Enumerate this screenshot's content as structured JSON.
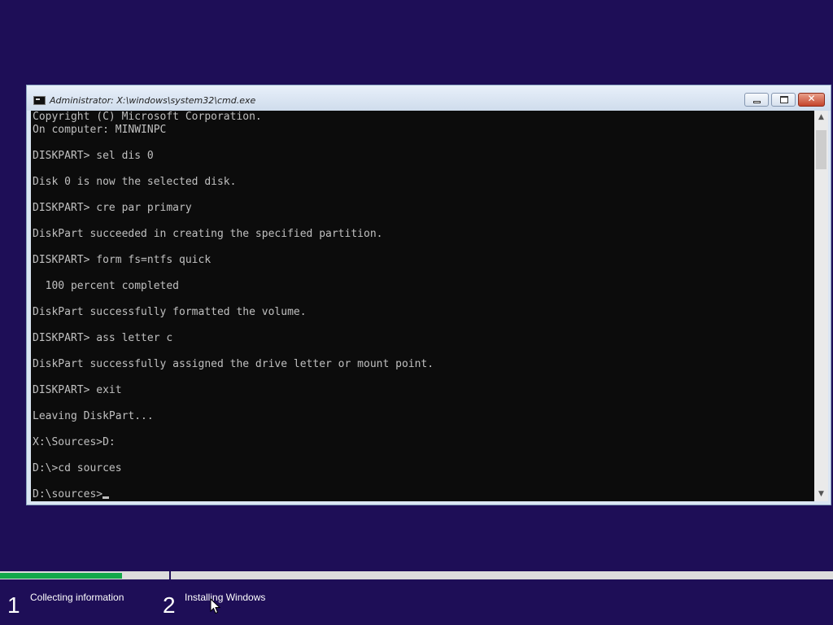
{
  "window": {
    "title": "Administrator: X:\\windows\\system32\\cmd.exe",
    "close_glyph": "✕"
  },
  "console": {
    "lines": [
      "Copyright (C) Microsoft Corporation.",
      "On computer: MINWINPC",
      "",
      "DISKPART> sel dis 0",
      "",
      "Disk 0 is now the selected disk.",
      "",
      "DISKPART> cre par primary",
      "",
      "DiskPart succeeded in creating the specified partition.",
      "",
      "DISKPART> form fs=ntfs quick",
      "",
      "  100 percent completed",
      "",
      "DiskPart successfully formatted the volume.",
      "",
      "DISKPART> ass letter c",
      "",
      "DiskPart successfully assigned the drive letter or mount point.",
      "",
      "DISKPART> exit",
      "",
      "Leaving DiskPart...",
      "",
      "X:\\Sources>D:",
      "",
      "D:\\>cd sources",
      "",
      "D:\\sources>"
    ]
  },
  "setup": {
    "progress_fraction": 0.146,
    "steps": [
      {
        "number": "1",
        "label": "Collecting information"
      },
      {
        "number": "2",
        "label": "Installing Windows"
      }
    ]
  },
  "icons": {
    "window_icon": "cmd-icon",
    "scroll_up": "▲",
    "scroll_down": "▼"
  },
  "colors": {
    "desktop_background": "#1e0e57",
    "console_background": "#0c0c0c",
    "console_text": "#c0c0c0",
    "progress_green": "#12a84a"
  }
}
